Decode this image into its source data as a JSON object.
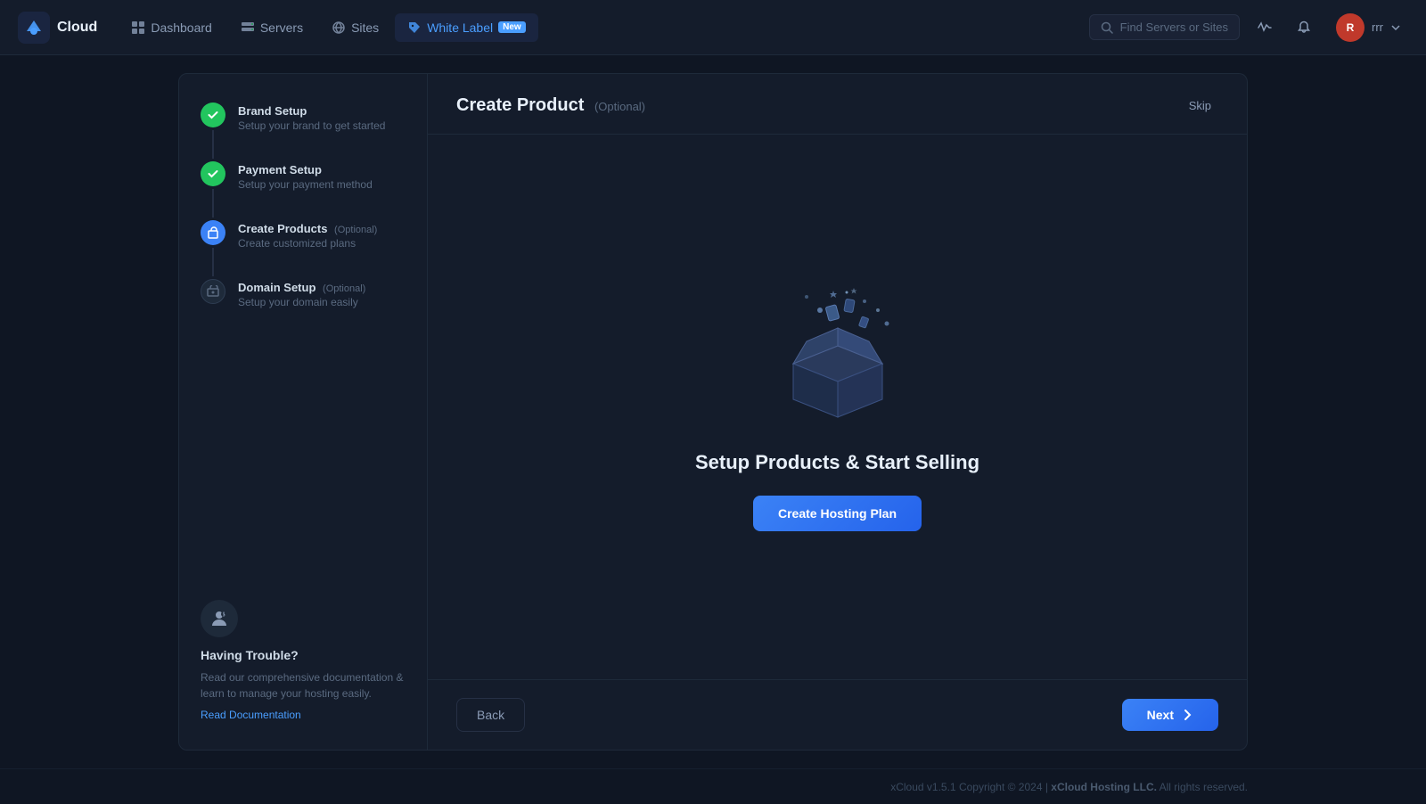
{
  "topbar": {
    "logo_text": "Cloud",
    "nav_items": [
      {
        "id": "dashboard",
        "label": "Dashboard",
        "icon": "grid"
      },
      {
        "id": "servers",
        "label": "Servers",
        "icon": "server"
      },
      {
        "id": "sites",
        "label": "Sites",
        "icon": "globe"
      },
      {
        "id": "white-label",
        "label": "White Label",
        "icon": "tag",
        "badge": "New",
        "active": true
      }
    ],
    "search_placeholder": "Find Servers or Sites",
    "username": "rrr"
  },
  "sidebar": {
    "steps": [
      {
        "id": "brand-setup",
        "title": "Brand Setup",
        "subtitle": "Setup your brand to get started",
        "status": "done",
        "optional": false
      },
      {
        "id": "payment-setup",
        "title": "Payment Setup",
        "subtitle": "Setup your payment method",
        "status": "done",
        "optional": false
      },
      {
        "id": "create-products",
        "title": "Create Products",
        "subtitle": "Create customized plans",
        "status": "active",
        "optional": true
      },
      {
        "id": "domain-setup",
        "title": "Domain Setup",
        "subtitle": "Setup your domain easily",
        "status": "pending",
        "optional": true
      }
    ],
    "help": {
      "title": "Having Trouble?",
      "description": "Read our comprehensive documentation & learn to manage your hosting easily.",
      "link_text": "Read Documentation"
    }
  },
  "content": {
    "title": "Create Product",
    "optional_tag": "(Optional)",
    "skip_label": "Skip",
    "setup_title": "Setup Products & Start Selling",
    "create_btn_label": "Create Hosting Plan",
    "back_btn_label": "Back",
    "next_btn_label": "Next"
  },
  "footer": {
    "version": "xCloud v1.5.1",
    "copyright": "Copyright © 2024 |",
    "company": "xCloud Hosting LLC.",
    "rights": "All rights reserved."
  }
}
